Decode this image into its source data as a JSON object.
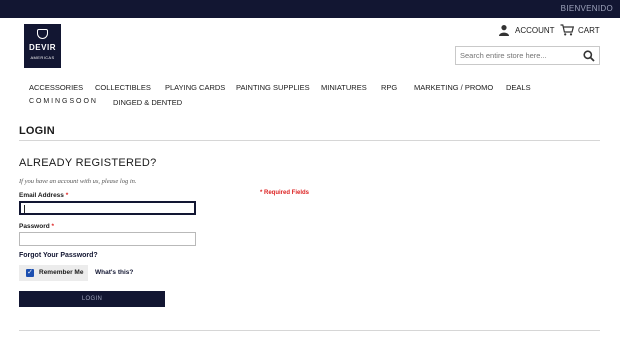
{
  "topbar": {
    "welcome": "BIENVENIDO"
  },
  "logo": {
    "brand": "DEVIR",
    "subtitle": "AMERICAS"
  },
  "header": {
    "account_label": "ACCOUNT",
    "cart_label": "CART",
    "search_placeholder": "Search entire store here..."
  },
  "nav": {
    "items": [
      "ACCESSORIES",
      "COLLECTIBLES",
      "PLAYING CARDS",
      "PAINTING SUPPLIES",
      "MINIATURES",
      "RPG",
      "MARKETING / PROMO",
      "DEALS",
      "C O M I N G S O O N",
      "DINGED & DENTED"
    ]
  },
  "page": {
    "title": "LOGIN",
    "section_title": "ALREADY REGISTERED?",
    "hint": "If you have an account with us, please log in.",
    "required_note": "* Required Fields"
  },
  "form": {
    "email_label": "Email Address",
    "email_value": "",
    "password_label": "Password",
    "password_value": "",
    "required_mark": "*",
    "forgot_link": "Forgot Your Password?",
    "remember_label": "Remember Me",
    "remember_checked": true,
    "whats_this": "What's this?",
    "submit_label": "LOGIN"
  },
  "colors": {
    "brand_navy": "#121632",
    "required_red": "#dd2222",
    "checkbox_blue": "#1c4fb0"
  },
  "icons": {
    "account": "user-icon",
    "cart": "cart-icon",
    "search": "search-icon",
    "checkbox": "checkmark"
  }
}
